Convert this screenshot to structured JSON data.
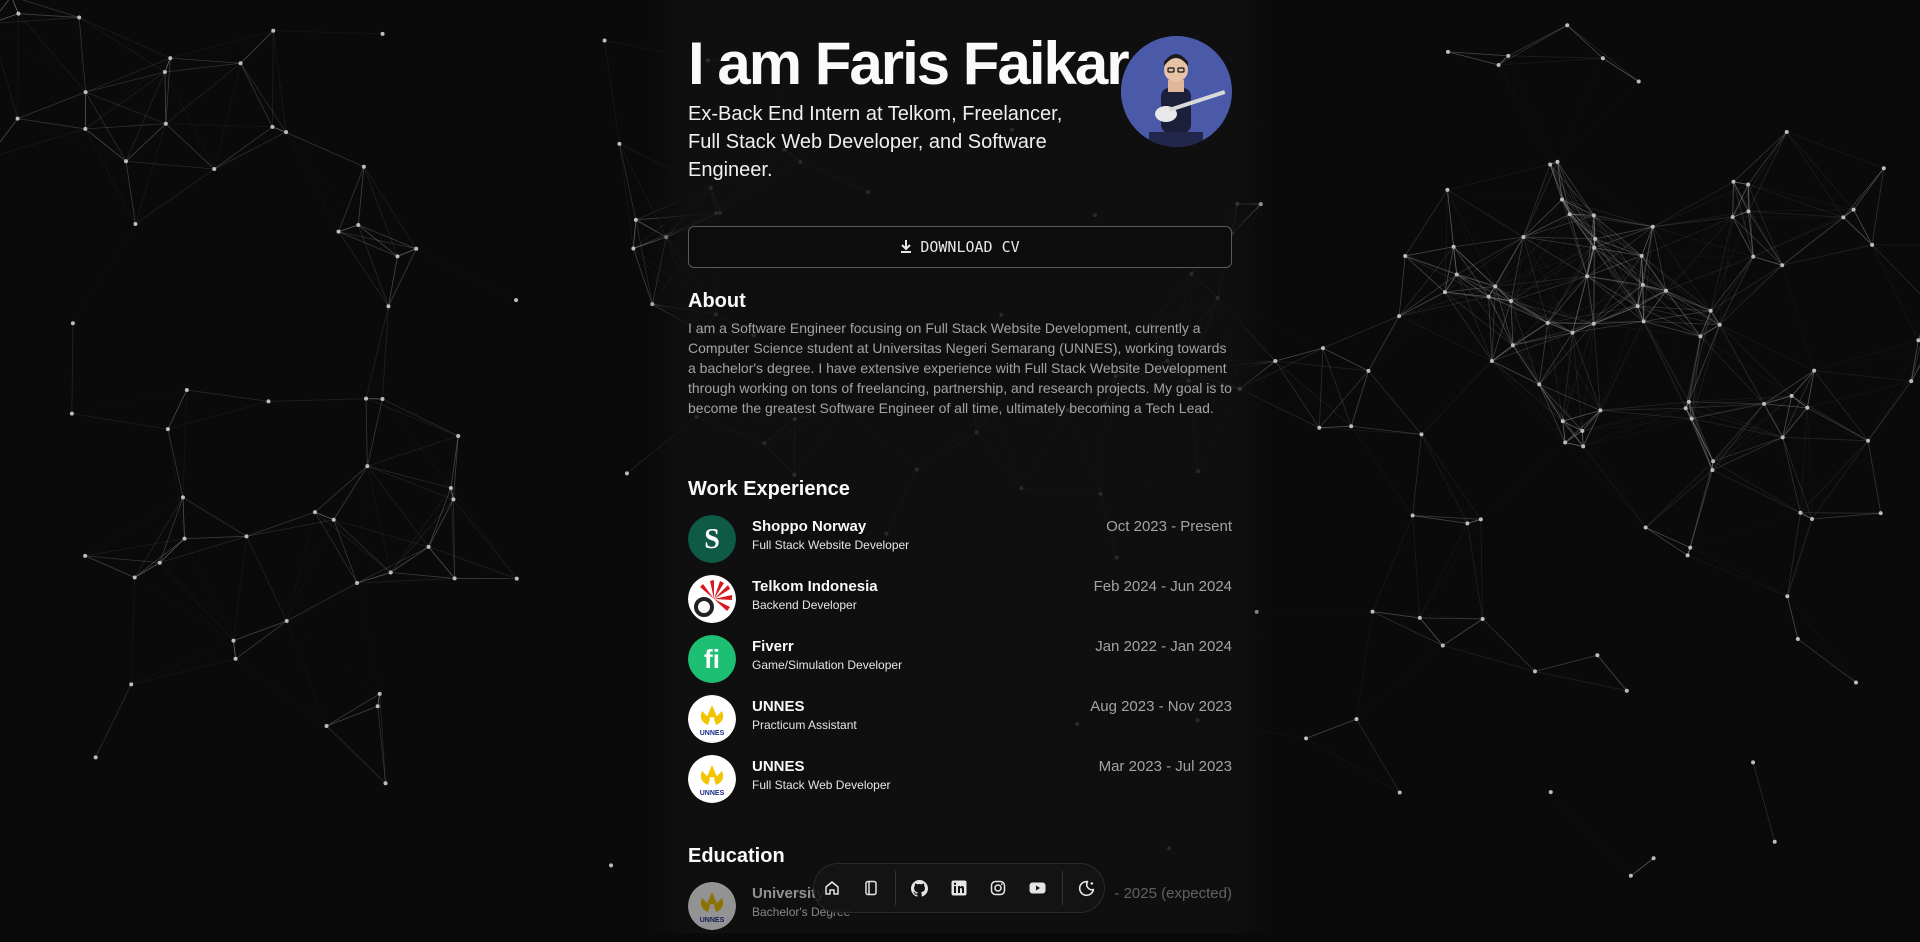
{
  "hero": {
    "name": "I am Faris Faikar",
    "tagline": "Ex-Back End Intern at Telkom, Freelancer, Full Stack Web Developer, and Software Engineer.",
    "download_cv_label": "DOWNLOAD CV"
  },
  "about": {
    "title": "About",
    "text": "I am a Software Engineer focusing on Full Stack Website Development, currently a Computer Science student at Universitas Negeri Semarang (UNNES), working towards a bachelor's degree. I have extensive experience with Full Stack Website Development through working on tons of freelancing, partnership, and research projects. My goal is to become the greatest Software Engineer of all time, ultimately becoming a Tech Lead."
  },
  "work": {
    "title": "Work Experience",
    "items": [
      {
        "company": "Shoppo Norway",
        "role": "Full Stack Website Developer",
        "dates": "Oct 2023 - Present"
      },
      {
        "company": "Telkom Indonesia",
        "role": "Backend Developer",
        "dates": "Feb 2024 - Jun 2024"
      },
      {
        "company": "Fiverr",
        "role": "Game/Simulation Developer",
        "dates": "Jan 2022 - Jan 2024"
      },
      {
        "company": "UNNES",
        "role": "Practicum Assistant",
        "dates": "Aug 2023 - Nov 2023"
      },
      {
        "company": "UNNES",
        "role": "Full Stack Web Developer",
        "dates": "Mar 2023 - Jul 2023"
      }
    ]
  },
  "education": {
    "title": "Education",
    "items": [
      {
        "school": "University",
        "degree": "Bachelor's Degree",
        "dates": "- 2025 (expected)"
      }
    ]
  },
  "logos": {
    "shoppo_badge": "S",
    "fiverr_badge": "fi",
    "unnes_badge": "UNNES"
  },
  "dock": {
    "icons": [
      "home-icon",
      "notebook-icon",
      "github-icon",
      "linkedin-icon",
      "instagram-icon",
      "youtube-icon",
      "theme-toggle-icon"
    ]
  },
  "colors": {
    "background": "#0a0a0a",
    "shoppo": "#0f5a45",
    "fiverr": "#1dbf73",
    "avatar_bg": "#4a5aa8"
  }
}
